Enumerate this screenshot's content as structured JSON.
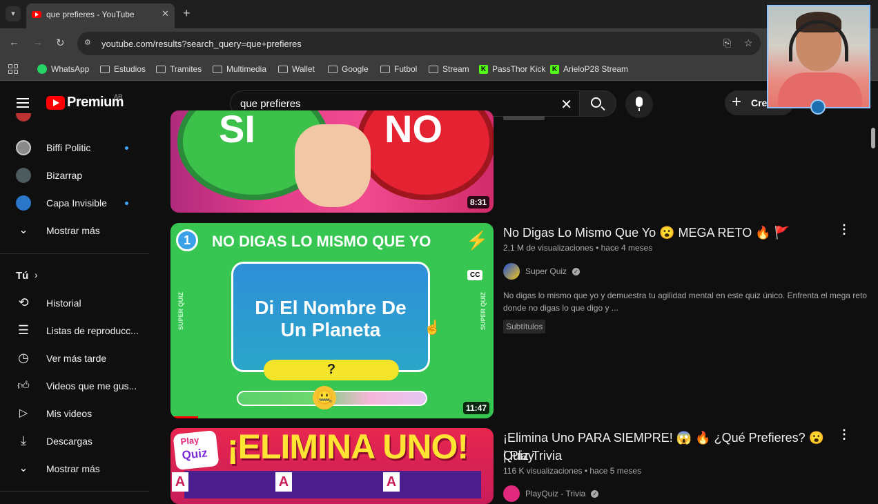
{
  "browser": {
    "tab_title": "que prefieres - YouTube",
    "url": "youtube.com/results?search_query=que+prefieres",
    "bookmarks": [
      "WhatsApp",
      "Estudios",
      "Tramites",
      "Multimedia",
      "Wallet",
      "Google",
      "Futbol",
      "Stream",
      "PassThor Kick",
      "ArieloP28 Stream"
    ]
  },
  "header": {
    "logo": "Premium",
    "country": "AR",
    "search_value": "que prefieres",
    "create_label": "Crea"
  },
  "sidebar": {
    "subscriptions": [
      {
        "label": "Biffi Politic",
        "dot": true
      },
      {
        "label": "Bizarrap",
        "dot": false
      },
      {
        "label": "Capa Invisible",
        "dot": true
      }
    ],
    "show_more_1": "Mostrar más",
    "you_section": "Tú",
    "you_items": [
      "Historial",
      "Listas de reproducc...",
      "Ver más tarde",
      "Videos que me gus...",
      "Mis videos",
      "Descargas"
    ],
    "show_more_2": "Mostrar más"
  },
  "results": [
    {
      "duration": "8:31",
      "thumb_text_left": "SI",
      "thumb_text_right": "NO"
    },
    {
      "title": "No Digas Lo Mismo Que Yo 😮 MEGA RETO 🔥 🚩",
      "meta": "2,1 M de visualizaciones • hace 4 meses",
      "channel": "Super Quiz",
      "description_line1": "No digas lo mismo que yo y demuestra tu agilidad mental en este quiz único. Enfrenta el mega reto",
      "description_line2": "donde no digas lo que digo y ...",
      "badge": "Subtítulos",
      "duration": "11:47",
      "thumb_number": "1",
      "thumb_header": "NO DIGAS LO MISMO QUE YO",
      "thumb_card_line1": "Di El Nombre De",
      "thumb_card_line2": "Un Planeta",
      "thumb_answer": "?",
      "thumb_side": "SUPER QUIZ",
      "thumb_cc": "CC"
    },
    {
      "title_line1": "¡Elimina Uno PARA SIEMPRE! 😱 🔥 ¿Qué Prefieres? 😮 | Play",
      "title_line2": "Quiz Trivia",
      "meta": "116 K visualizaciones • hace 5 meses",
      "channel": "PlayQuiz - Trivia",
      "thumb_header": "¡ELIMINA UNO!",
      "thumb_logo_1": "Play",
      "thumb_logo_2": "Quiz",
      "thumb_tag": "A"
    }
  ],
  "colors": {
    "background": "#0f0f0f",
    "brand_red": "#ff0000",
    "accent_blue": "#3ea6ff",
    "quiz_green": "#34c759"
  }
}
